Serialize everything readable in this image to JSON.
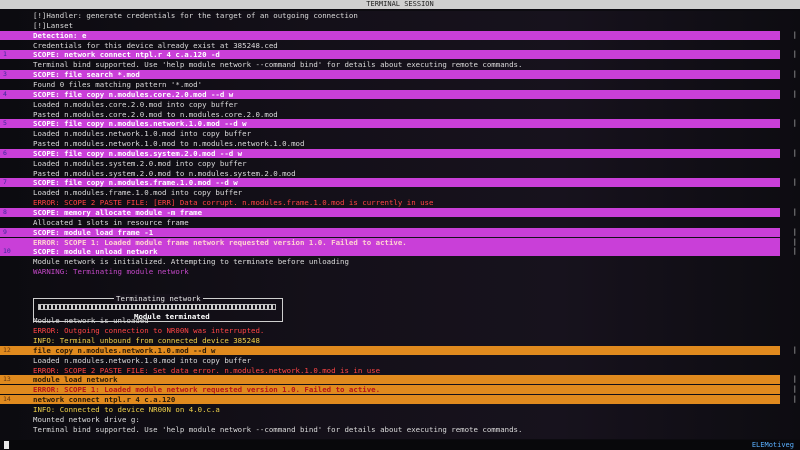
{
  "window": {
    "title": "TERMINAL SESSION"
  },
  "terminal": {
    "lines": [
      {
        "t": "[!]Handler: generate credentials for the target of an outgoing connection",
        "s": "w",
        "g": ""
      },
      {
        "t": "[!]Lanset",
        "s": "w",
        "g": ""
      },
      {
        "t": "Detection: e",
        "s": "w",
        "g": "",
        "hl": "m",
        "w": 780
      },
      {
        "t": "Credentials for this device already exist at 385248.ced",
        "s": "w",
        "g": ""
      },
      {
        "t": "SCOPE: network connect ntpl.r 4 c.a.120 -d",
        "s": "w",
        "g": "1",
        "hl": "m",
        "w": 780
      },
      {
        "t": "Terminal bind supported. Use 'help module network --command bind' for details about executing remote commands.",
        "s": "w",
        "g": ""
      },
      {
        "t": "SCOPE: file search *.mod",
        "s": "w",
        "g": "3",
        "hl": "m",
        "w": 780
      },
      {
        "t": "Found 0 files matching pattern '*.mod'",
        "s": "w",
        "g": ""
      },
      {
        "t": "SCOPE: file copy n.modules.core.2.0.mod --d w",
        "s": "w",
        "g": "4",
        "hl": "m",
        "w": 780
      },
      {
        "t": "Loaded n.modules.core.2.0.mod into copy buffer",
        "s": "w",
        "g": ""
      },
      {
        "t": "Pasted n.modules.core.2.0.mod to n.modules.core.2.0.mod",
        "s": "w",
        "g": ""
      },
      {
        "t": "SCOPE: file copy n.modules.network.1.0.mod --d w",
        "s": "w",
        "g": "5",
        "hl": "m",
        "w": 780
      },
      {
        "t": "Loaded n.modules.network.1.0.mod into copy buffer",
        "s": "w",
        "g": ""
      },
      {
        "t": "Pasted n.modules.network.1.0.mod to n.modules.network.1.0.mod",
        "s": "w",
        "g": ""
      },
      {
        "t": "SCOPE: file copy n.modules.system.2.0.mod --d w",
        "s": "w",
        "g": "6",
        "hl": "m",
        "w": 780
      },
      {
        "t": "Loaded n.modules.system.2.0.mod into copy buffer",
        "s": "w",
        "g": ""
      },
      {
        "t": "Pasted n.modules.system.2.0.mod to n.modules.system.2.0.mod",
        "s": "w",
        "g": ""
      },
      {
        "t": "SCOPE: file copy n.modules.frame.1.0.mod --d w",
        "s": "w",
        "g": "7",
        "hl": "m",
        "w": 780
      },
      {
        "t": "Loaded n.modules.frame.1.0.mod into copy buffer",
        "s": "w",
        "g": ""
      },
      {
        "t": "ERROR: SCOPE 2 PASTE FILE: [ERR] Data corrupt. n.modules.frame.1.0.mod is currently in use",
        "s": "r",
        "g": ""
      },
      {
        "t": "SCOPE: memory allocate module -m frame",
        "s": "w",
        "g": "8",
        "hl": "m",
        "w": 780
      },
      {
        "t": "Allocated 1 slots in resource frame",
        "s": "w",
        "g": ""
      },
      {
        "t": "SCOPE: module load frame -1",
        "s": "w",
        "g": "9",
        "hl": "m",
        "w": 780
      },
      {
        "t": "ERROR: SCOPE 1: Loaded module frame network requested version 1.0. Failed to active.",
        "s": "r",
        "g": "",
        "hl": "m",
        "w": 780
      },
      {
        "t": "SCOPE: module unload network",
        "s": "w",
        "g": "10",
        "hl": "m",
        "w": 780
      },
      {
        "t": "Module network is initialized. Attempting to terminate before unloading",
        "s": "w",
        "g": ""
      },
      {
        "t": "WARNING: Terminating module network",
        "s": "m",
        "g": ""
      },
      {
        "t": "",
        "s": "w",
        "g": ""
      },
      {
        "t": "",
        "s": "w",
        "g": ""
      },
      {
        "t": "",
        "s": "w",
        "g": ""
      },
      {
        "t": "",
        "s": "w",
        "g": ""
      },
      {
        "t": "Module network is unloaded",
        "s": "w",
        "g": ""
      },
      {
        "t": "ERROR: Outgoing connection to NR00N was interrupted.",
        "s": "r",
        "g": ""
      },
      {
        "t": "INFO: Terminal unbound from connected device 385248",
        "s": "y",
        "g": ""
      },
      {
        "t": "file copy n.modules.network.1.0.mod --d w",
        "s": "w",
        "g": "12",
        "hl": "o",
        "w": 780
      },
      {
        "t": "Loaded n.modules.network.1.0.mod into copy buffer",
        "s": "w",
        "g": ""
      },
      {
        "t": "ERROR: SCOPE 2 PASTE FILE: Set data error. n.modules.network.1.0.mod is in use",
        "s": "r",
        "g": ""
      },
      {
        "t": "module load network",
        "s": "w",
        "g": "13",
        "hl": "o",
        "w": 780
      },
      {
        "t": "ERROR: SCOPE 1: Loaded module network requested version 1.0. Failed to active.",
        "s": "r",
        "g": "",
        "hl": "o",
        "w": 780
      },
      {
        "t": "network connect ntpl.r 4 c.a.120",
        "s": "w",
        "g": "14",
        "hl": "o",
        "w": 780
      },
      {
        "t": "INFO: Connected to device NR00N on 4.0.c.a",
        "s": "y",
        "g": ""
      },
      {
        "t": "Mounted network drive g:",
        "s": "w",
        "g": ""
      },
      {
        "t": "Terminal bind supported. Use 'help module network --command bind' for details about executing remote commands.",
        "s": "w",
        "g": ""
      }
    ],
    "progress": {
      "label": "Terminating network",
      "fraction": 1.0,
      "done_label": "Module terminated"
    }
  },
  "status": {
    "right_text": "ELEMotiveg"
  }
}
